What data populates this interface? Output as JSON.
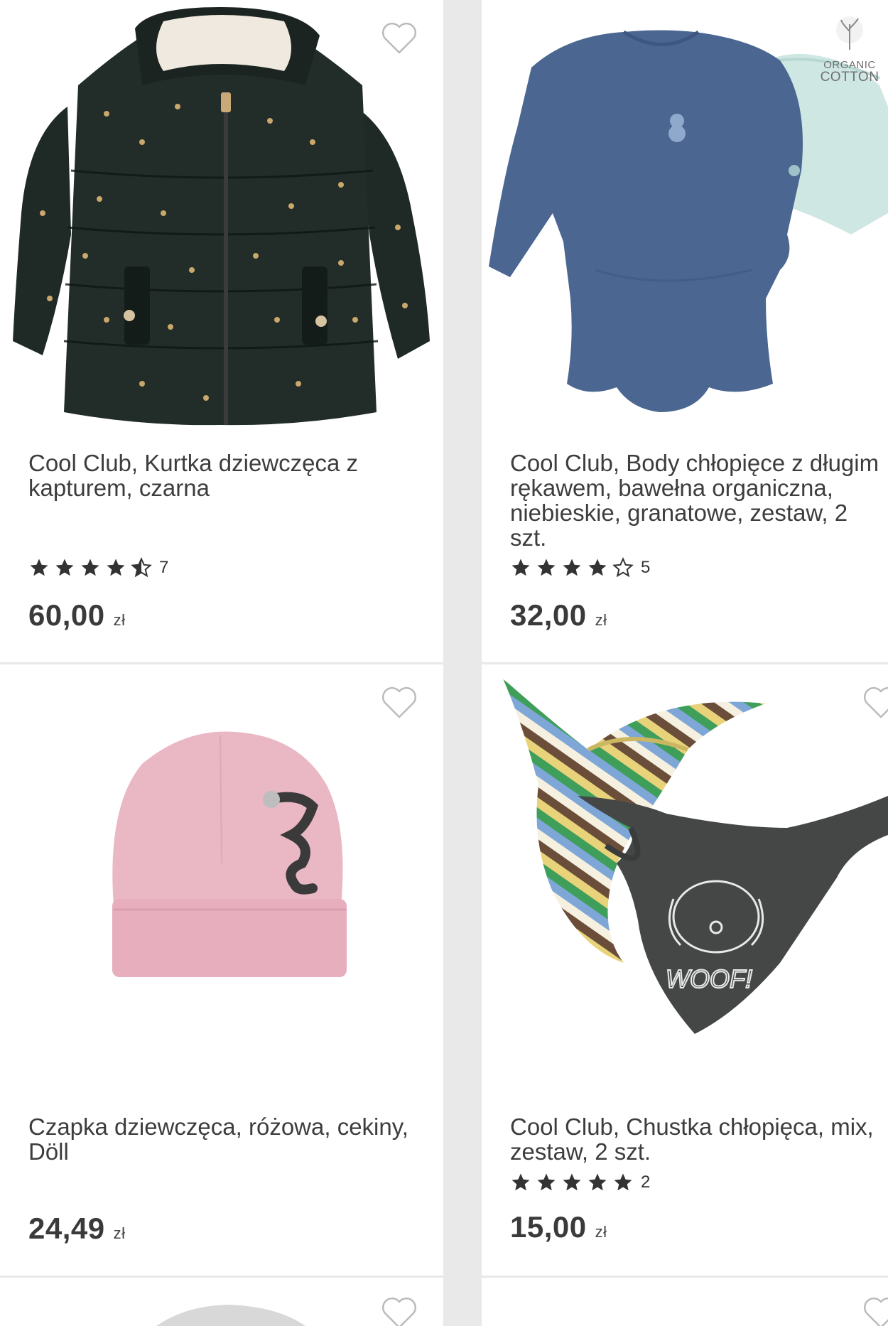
{
  "products": [
    {
      "title": "Cool Club, Kurtka dziewczęca z kapturem, czarna",
      "rating": 4.5,
      "review_count": "7",
      "price": "60,00",
      "currency": "zł",
      "image_icon": "puffer-jacket-image"
    },
    {
      "title": "Cool Club, Body chłopięce z długim rękawem, bawełna organiczna, niebieskie, granatowe, zestaw, 2 szt.",
      "rating": 4,
      "review_count": "5",
      "price": "32,00",
      "currency": "zł",
      "image_icon": "bodysuit-set-image",
      "badge_line1": "ORGANIC",
      "badge_line2": "COTTON"
    },
    {
      "title": "Czapka dziewczęca, różowa, cekiny, Döll",
      "price": "24,49",
      "currency": "zł",
      "image_icon": "pink-beanie-image"
    },
    {
      "title": "Cool Club, Chustka chłopięca, mix, zestaw, 2 szt.",
      "rating": 5,
      "review_count": "2",
      "price": "15,00",
      "currency": "zł",
      "image_icon": "bandana-set-image",
      "print_text": "WOOF!"
    }
  ],
  "colors": {
    "background": "#e9e9e9",
    "card": "#ffffff",
    "star": "#333333",
    "text": "#3d3d3d"
  }
}
